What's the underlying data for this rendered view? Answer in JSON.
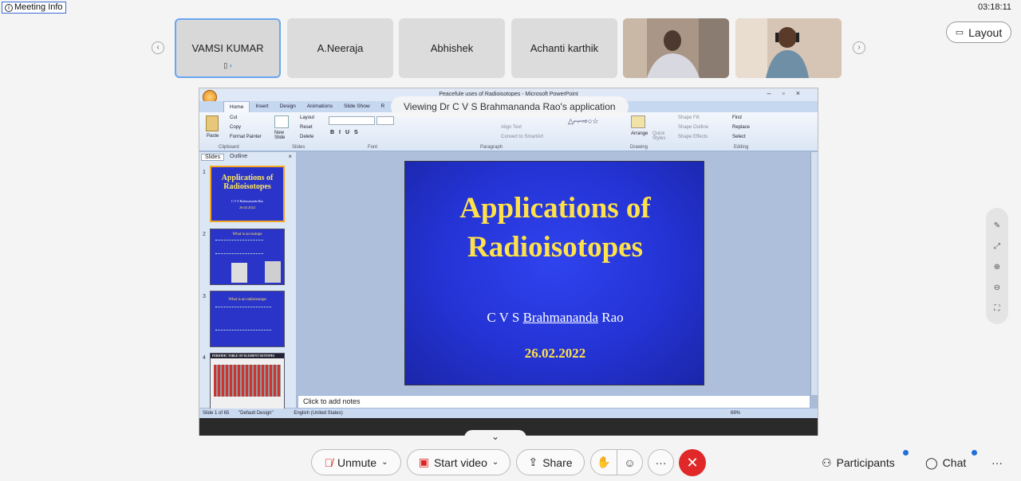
{
  "meeting_info": {
    "label": "Meeting Info"
  },
  "clock": "03:18:11",
  "layout_button": {
    "label": "Layout"
  },
  "participants": [
    {
      "name": "VAMSI KUMAR",
      "active": true
    },
    {
      "name": "A.Neeraja"
    },
    {
      "name": "Abhishek"
    },
    {
      "name": "Achanti karthik"
    },
    {
      "name": "",
      "video": true
    },
    {
      "name": "",
      "video": true
    }
  ],
  "share": {
    "viewing_banner": "Viewing Dr C V S Brahmananda Rao's application",
    "window_title": "Peacefule uses of Radioisotopes - Microsoft PowerPoint",
    "ribbon_tabs": [
      "Home",
      "Insert",
      "Design",
      "Animations",
      "Slide Show",
      "R"
    ],
    "ribbon_groups": [
      "Clipboard",
      "Slides",
      "Font",
      "Paragraph",
      "Drawing",
      "Editing"
    ],
    "ribbon_items": {
      "cut": "Cut",
      "copy": "Copy",
      "format_painter": "Format Painter",
      "paste": "Paste",
      "layout": "Layout",
      "reset": "Reset",
      "delete": "Delete",
      "new_slide": "New Slide",
      "align_text": "Align Text",
      "convert": "Convert to SmartArt",
      "arrange": "Arrange",
      "quick_styles": "Quick Styles",
      "shape_fill": "Shape Fill",
      "shape_outline": "Shape Outline",
      "shape_effects": "Shape Effects",
      "find": "Find",
      "replace": "Replace",
      "select": "Select"
    },
    "pane_tabs": [
      "Slides",
      "Outline"
    ],
    "thumbnails": [
      {
        "num": "1",
        "title": "Applications of Radioisotopes",
        "sub": "C V S Brahmananda Rao",
        "date": "26.02.2022"
      },
      {
        "num": "2",
        "title": "What is an isotope"
      },
      {
        "num": "3",
        "title": "What is an radioisotope"
      },
      {
        "num": "4",
        "title": "PERIODIC TABLE OF ELEMENT ISOTOPES"
      }
    ],
    "slide": {
      "title_line1": "Applications of",
      "title_line2": "Radioisotopes",
      "author_prefix": "C V S ",
      "author_underlined": "Brahmananda",
      "author_suffix": " Rao",
      "date": "26.02.2022"
    },
    "notes_placeholder": "Click to add notes",
    "status": {
      "slide_count": "Slide 1 of 65",
      "design": "\"Default Design\"",
      "language": "English (United States)",
      "zoom": "69%"
    }
  },
  "controls": {
    "unmute": "Unmute",
    "start_video": "Start video",
    "share": "Share",
    "participants": "Participants",
    "chat": "Chat"
  },
  "colors": {
    "accent": "#1e6fd9",
    "end_call": "#e02828",
    "slide_bg": "#2433d4",
    "slide_title": "#ffe24a"
  }
}
